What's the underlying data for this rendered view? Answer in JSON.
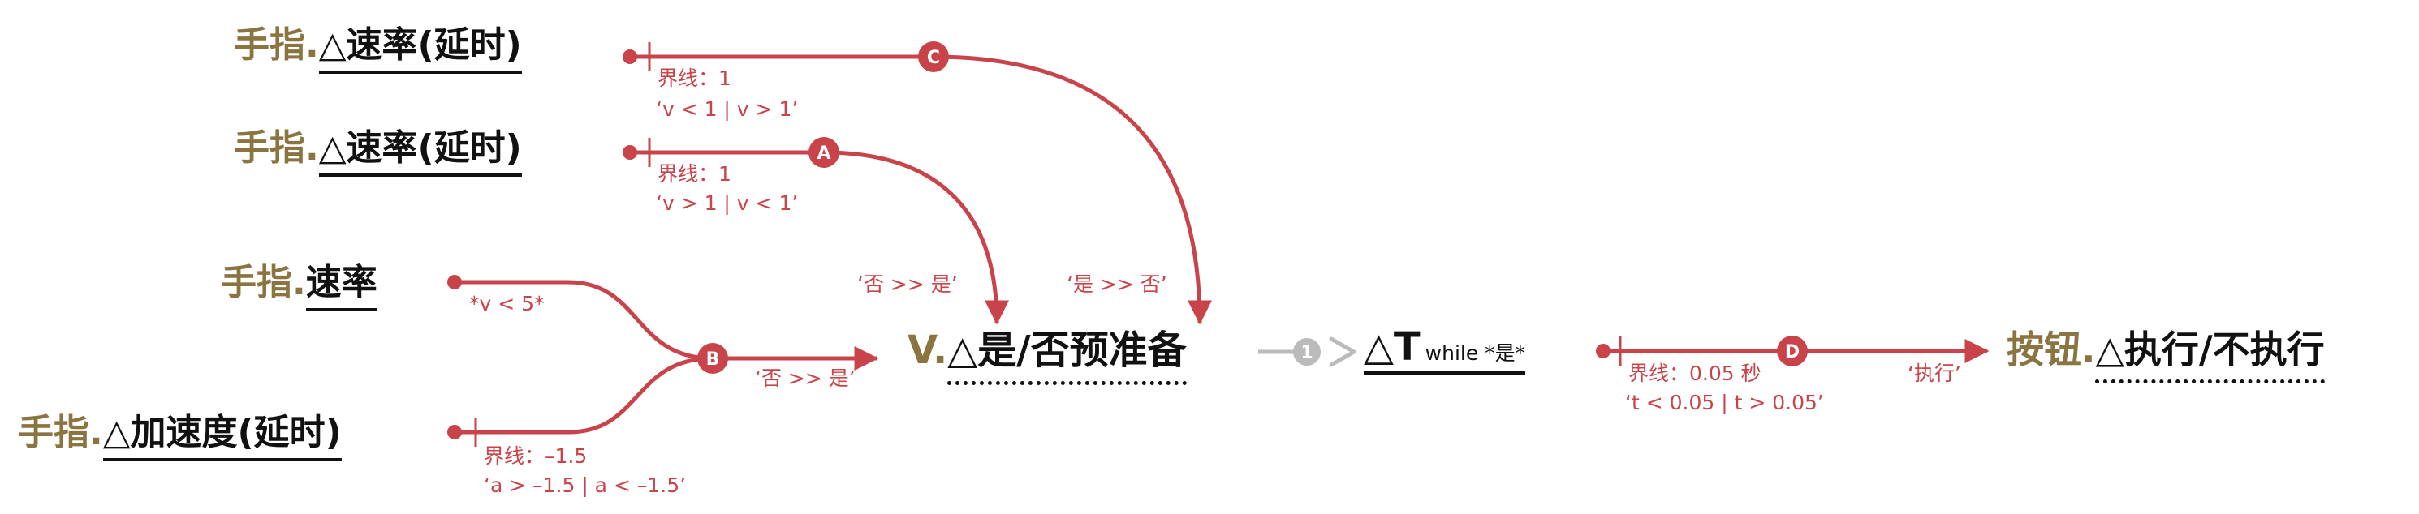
{
  "colors": {
    "edge": "#c9444a",
    "inactive": "#bbbbbb",
    "prefix": "#8a7440",
    "text": "#111111"
  },
  "nodes": {
    "input_c": {
      "prefix": "手指.",
      "label": "△速率(延时)"
    },
    "input_a": {
      "prefix": "手指.",
      "label": "△速率(延时)"
    },
    "input_speed": {
      "prefix": "手指.",
      "label": "速率"
    },
    "input_accel": {
      "prefix": "手指.",
      "label": "△加速度(延时)"
    },
    "variable": {
      "prefix": "V.",
      "label": "△是/否预准备"
    },
    "timer": {
      "label": "△T",
      "subscript": "while *是*"
    },
    "output": {
      "prefix": "按钮.",
      "label": "△执行/不执行"
    }
  },
  "badges": {
    "a": "A",
    "b": "B",
    "c": "C",
    "d": "D",
    "one": "1"
  },
  "annotations": {
    "c_threshold": "界线：1",
    "c_cond": "‘v < 1 | v > 1’",
    "a_threshold": "界线：1",
    "a_cond": "‘v > 1 | v < 1’",
    "a_map": "‘否 >> 是’",
    "c_map": "‘是 >> 否’",
    "speed_cond": "*v < 5*",
    "accel_threshold": "界线：–1.5",
    "accel_cond": "‘a > –1.5 | a < –1.5’",
    "b_map": "‘否 >> 是’",
    "d_threshold": "界线：0.05 秒",
    "d_cond": "‘t < 0.05 | t > 0.05’",
    "d_out": "‘执行’"
  }
}
